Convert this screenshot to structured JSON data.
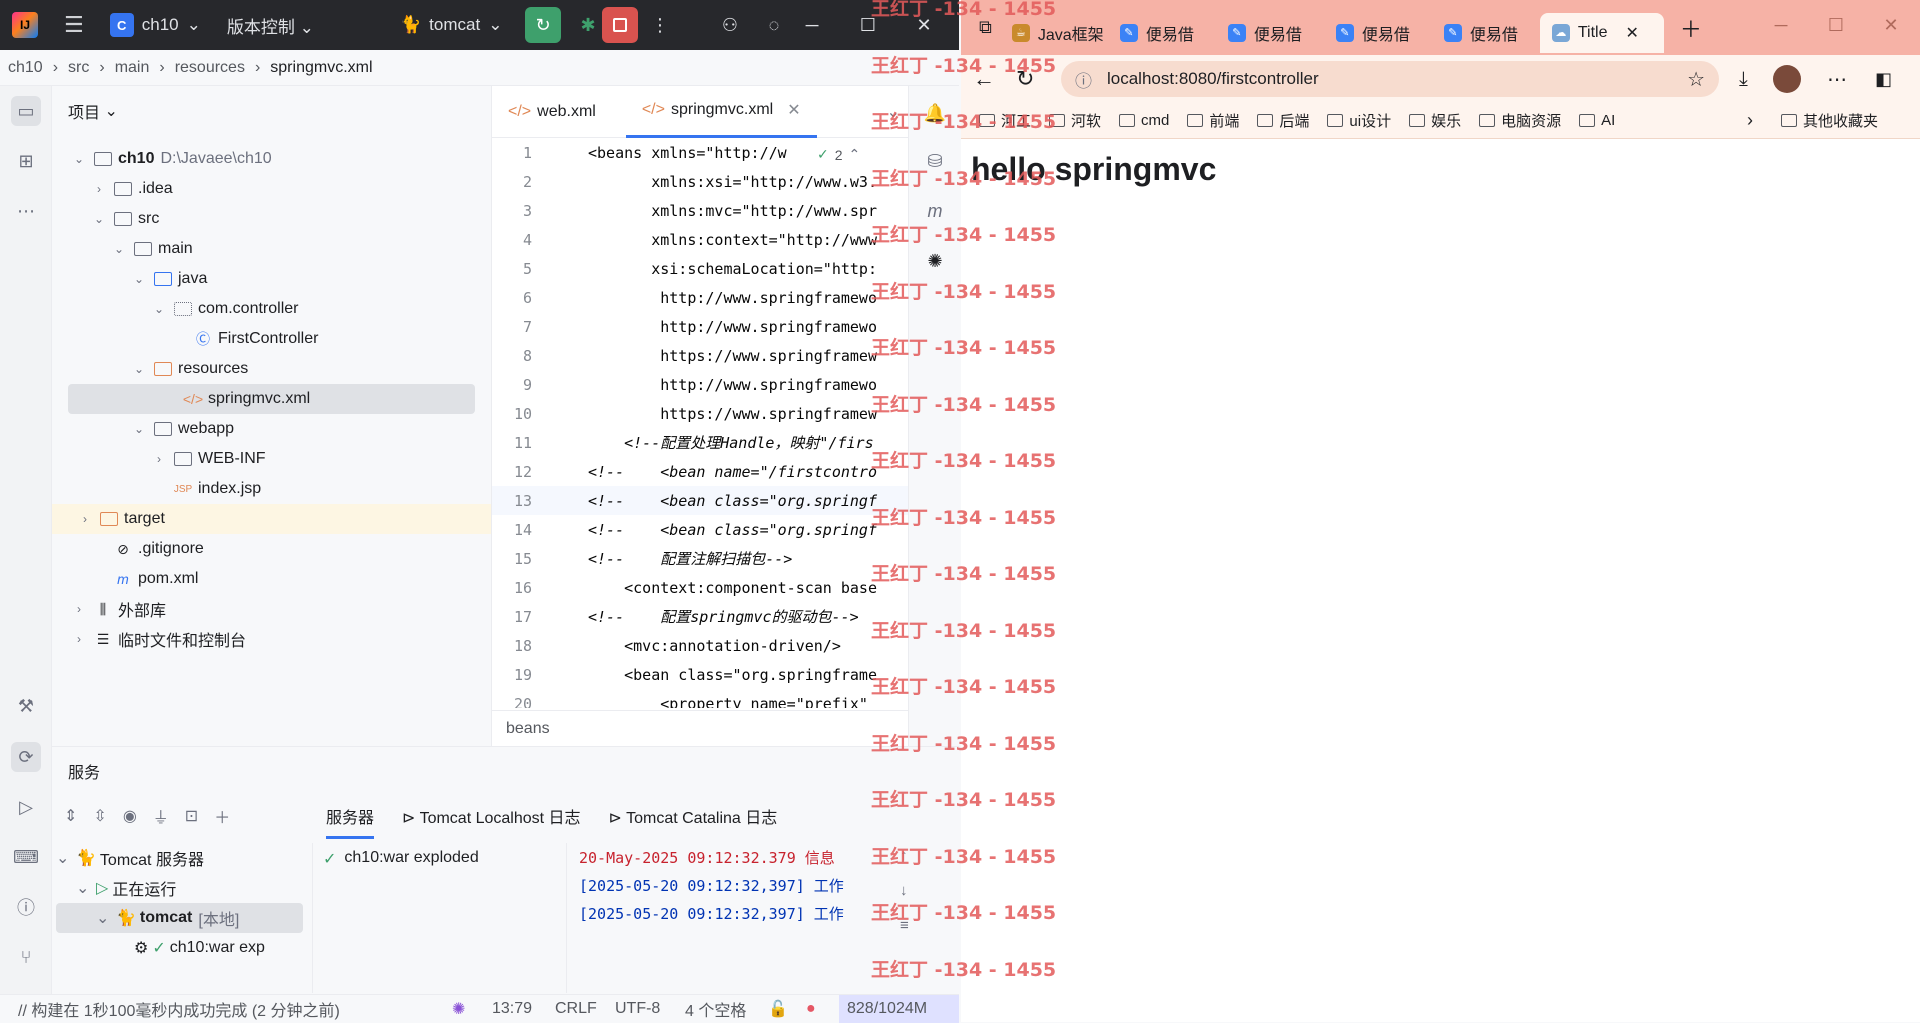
{
  "ide": {
    "project_name": "ch10",
    "project_badge": "C",
    "version_control": "版本控制",
    "run_config": "tomcat",
    "breadcrumb": [
      "ch10",
      "src",
      "main",
      "resources",
      "springmvc.xml"
    ],
    "project_panel_title": "项目",
    "tree": [
      {
        "label": "ch10",
        "hint": "D:\\Javaee\\ch10",
        "bold": true
      },
      {
        "label": ".idea"
      },
      {
        "label": "src"
      },
      {
        "label": "main"
      },
      {
        "label": "java"
      },
      {
        "label": "com.controller"
      },
      {
        "label": "FirstController"
      },
      {
        "label": "resources"
      },
      {
        "label": "springmvc.xml"
      },
      {
        "label": "webapp"
      },
      {
        "label": "WEB-INF"
      },
      {
        "label": "index.jsp"
      },
      {
        "label": "target"
      },
      {
        "label": ".gitignore"
      },
      {
        "label": "pom.xml"
      },
      {
        "label": "外部库"
      },
      {
        "label": "临时文件和控制台"
      }
    ],
    "editor_tabs": [
      "web.xml",
      "springmvc.xml"
    ],
    "inspection_count": "2",
    "code_lines": [
      {
        "n": "1",
        "text": "<beans xmlns=\"http://w"
      },
      {
        "n": "2",
        "text": "       xmlns:xsi=\"http://www.w3."
      },
      {
        "n": "3",
        "text": "       xmlns:mvc=\"http://www.spr"
      },
      {
        "n": "4",
        "text": "       xmlns:context=\"http://www"
      },
      {
        "n": "5",
        "text": "       xsi:schemaLocation=\"http:"
      },
      {
        "n": "6",
        "text": "        http://www.springframewo"
      },
      {
        "n": "7",
        "text": "        http://www.springframewo"
      },
      {
        "n": "8",
        "text": "        https://www.springframew"
      },
      {
        "n": "9",
        "text": "        http://www.springframewo"
      },
      {
        "n": "10",
        "text": "        https://www.springframew"
      },
      {
        "n": "11",
        "text": "    <!--配置处理Handle，映射\"/firs"
      },
      {
        "n": "12",
        "text": "<!--    <bean name=\"/firstcontro"
      },
      {
        "n": "13",
        "text": "<!--    <bean class=\"org.springf"
      },
      {
        "n": "14",
        "text": "<!--    <bean class=\"org.springf"
      },
      {
        "n": "15",
        "text": "<!--    配置注解扫描包-->"
      },
      {
        "n": "16",
        "text": "    <context:component-scan base"
      },
      {
        "n": "17",
        "text": "<!--    配置springmvc的驱动包-->"
      },
      {
        "n": "18",
        "text": "    <mvc:annotation-driven/>"
      },
      {
        "n": "19",
        "text": "    <bean class=\"org.springframe"
      },
      {
        "n": "20",
        "text": "        <property name=\"prefix\""
      }
    ],
    "editor_breadcrumb": "beans",
    "services_title": "服务",
    "services_tabs": [
      "服务器",
      "Tomcat Localhost 日志",
      "Tomcat Catalina 日志"
    ],
    "services_tree": [
      {
        "label": "Tomcat 服务器"
      },
      {
        "label": "正在运行"
      },
      {
        "label": "tomcat",
        "hint": "[本地]"
      },
      {
        "label": "ch10:war exp"
      }
    ],
    "deployment": "ch10:war exploded",
    "console_lines": [
      {
        "text": "20-May-2025 09:12:32.379 信息",
        "color": "#c7222d"
      },
      {
        "text": "[2025-05-20 09:12:32,397] 工作",
        "color": "#0033b3"
      },
      {
        "text": "[2025-05-20 09:12:32,397] 工作",
        "color": "#0033b3"
      }
    ],
    "status": {
      "message": "// 构建在 1秒100毫秒内成功完成 (2 分钟之前)",
      "position": "13:79",
      "line_sep": "CRLF",
      "encoding": "UTF-8",
      "indent": "4 个空格",
      "memory": "828/1024M"
    }
  },
  "browser": {
    "tabs": [
      "Java框架",
      "便易借",
      "便易借",
      "便易借",
      "便易借",
      "Title"
    ],
    "url": "localhost:8080/firstcontroller",
    "bookmarks": [
      "河工",
      "河软",
      "cmd",
      "前端",
      "后端",
      "ui设计",
      "娱乐",
      "电脑资源",
      "AI"
    ],
    "other_bookmarks": "其他收藏夹",
    "page_heading": "hello springmvc"
  },
  "watermark": "王红丁 -134 - 1455"
}
